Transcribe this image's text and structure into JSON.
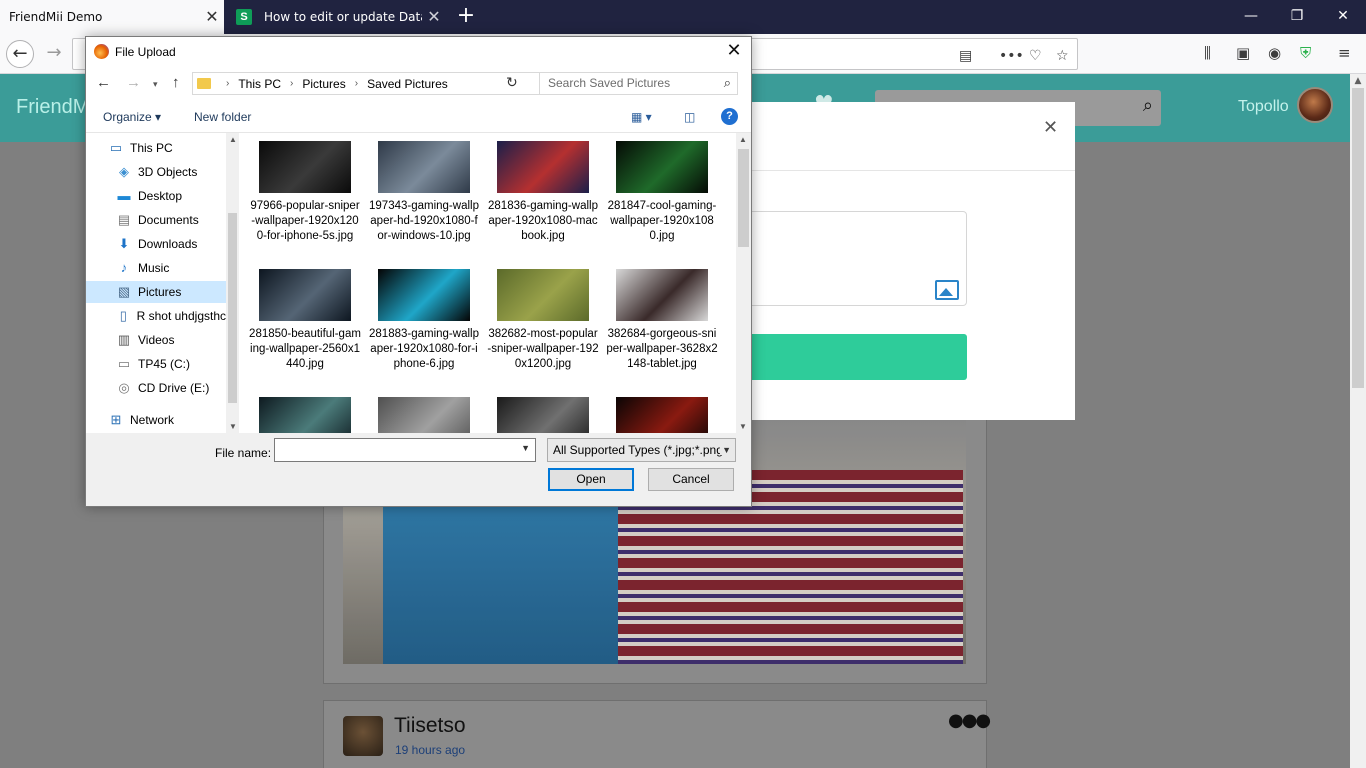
{
  "browser": {
    "tabs": [
      {
        "title": "FriendMii Demo",
        "active": true
      },
      {
        "title": "How to edit or update Data usin",
        "active": false,
        "favicon_letter": "S"
      }
    ],
    "new_tab_glyph": "+"
  },
  "page": {
    "brand": "FriendMi",
    "username": "Topollo",
    "post": {
      "author": "Tiisetso",
      "time": "19 hours ago"
    }
  },
  "dialog": {
    "title": "File Upload",
    "breadcrumb": [
      "This PC",
      "Pictures",
      "Saved Pictures"
    ],
    "search_placeholder": "Search Saved Pictures",
    "toolbar": {
      "organize": "Organize",
      "new_folder": "New folder",
      "help": "?"
    },
    "nav_items": [
      {
        "label": "This PC",
        "icon": "computer-icon"
      },
      {
        "label": "3D Objects",
        "icon": "cube-icon"
      },
      {
        "label": "Desktop",
        "icon": "desktop-icon"
      },
      {
        "label": "Documents",
        "icon": "document-icon"
      },
      {
        "label": "Downloads",
        "icon": "download-icon"
      },
      {
        "label": "Music",
        "icon": "music-icon"
      },
      {
        "label": "Pictures",
        "icon": "pictures-icon",
        "selected": true
      },
      {
        "label": "R shot uhdjgsthc",
        "icon": "file-icon"
      },
      {
        "label": "Videos",
        "icon": "video-icon"
      },
      {
        "label": "TP45 (C:)",
        "icon": "drive-icon"
      },
      {
        "label": "CD Drive (E:)",
        "icon": "cd-drive-icon"
      },
      {
        "label": "Network",
        "icon": "network-icon"
      }
    ],
    "files": [
      {
        "name": "97966-popular-sniper-wallpaper-1920x1200-for-iphone-5s.jpg",
        "colors": [
          "#0a0a0a",
          "#3a3a3a"
        ]
      },
      {
        "name": "197343-gaming-wallpaper-hd-1920x1080-for-windows-10.jpg",
        "colors": [
          "#2f3a48",
          "#7b8a9a"
        ]
      },
      {
        "name": "281836-gaming-wallpaper-1920x1080-macbook.jpg",
        "colors": [
          "#1b1f4a",
          "#b53030"
        ]
      },
      {
        "name": "281847-cool-gaming-wallpaper-1920x1080.jpg",
        "colors": [
          "#050a05",
          "#1f6a2a"
        ]
      },
      {
        "name": "281850-beautiful-gaming-wallpaper-2560x1440.jpg",
        "colors": [
          "#0d1620",
          "#556575"
        ]
      },
      {
        "name": "281883-gaming-wallpaper-1920x1080-for-iphone-6.jpg",
        "colors": [
          "#040404",
          "#1fa6c8"
        ]
      },
      {
        "name": "382682-most-popular-sniper-wallpaper-1920x1200.jpg",
        "colors": [
          "#5b6a2a",
          "#9aa24a"
        ]
      },
      {
        "name": "382684-gorgeous-sniper-wallpaper-3628x2148-tablet.jpg",
        "colors": [
          "#d8d8d8",
          "#3a2a2a"
        ]
      },
      {
        "name": "",
        "colors": [
          "#0e1a20",
          "#4b7b7a"
        ]
      },
      {
        "name": "",
        "colors": [
          "#505050",
          "#a0a0a0"
        ]
      },
      {
        "name": "",
        "colors": [
          "#1a1a1a",
          "#707070"
        ]
      },
      {
        "name": "",
        "colors": [
          "#0a0505",
          "#8a1a10"
        ]
      }
    ],
    "file_name_label": "File name:",
    "file_name_value": "",
    "file_type": "All Supported Types (*.jpg;*.png",
    "open_label": "Open",
    "cancel_label": "Cancel"
  }
}
